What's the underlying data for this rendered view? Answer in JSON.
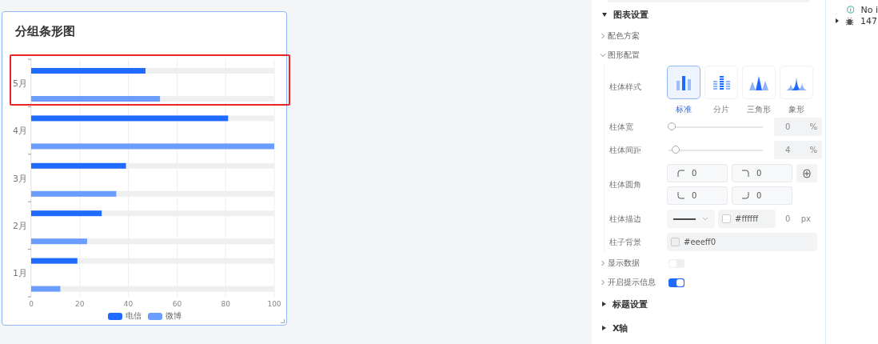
{
  "chart_card": {
    "title": "分组条形图",
    "highlight": {
      "kind": "box"
    },
    "bar_background": "#eeeff0",
    "chart_data": {
      "type": "bar",
      "orientation": "horizontal",
      "categories": [
        "5月",
        "4月",
        "3月",
        "2月",
        "1月"
      ],
      "series": [
        {
          "name": "电信",
          "color": "#1f6bff",
          "values": [
            47,
            81,
            39,
            29,
            19
          ]
        },
        {
          "name": "微博",
          "color": "#6b9cff",
          "values": [
            53,
            100,
            35,
            23,
            12
          ]
        }
      ],
      "xlim": [
        0,
        100
      ],
      "xticks": [
        0,
        20,
        40,
        60,
        80,
        100
      ],
      "grid": true
    }
  },
  "settings": {
    "sections": [
      {
        "title": "图表设置",
        "expanded": true,
        "groups": [
          {
            "title": "配色方案",
            "expanded": false
          },
          {
            "title": "图形配置",
            "expanded": true,
            "fields": [
              {
                "kind": "styles",
                "label": "柱体样式",
                "options": [
                  {
                    "kind": "standard",
                    "label": "标准",
                    "selected": true
                  },
                  {
                    "kind": "segmented",
                    "label": "分片",
                    "selected": false
                  },
                  {
                    "kind": "triangle",
                    "label": "三角形",
                    "selected": false
                  },
                  {
                    "kind": "pictorial",
                    "label": "象形",
                    "selected": false
                  }
                ]
              },
              {
                "kind": "slider",
                "label": "柱体宽",
                "level": 0,
                "value": "0",
                "unit": "%"
              },
              {
                "kind": "slider",
                "label": "柱体间距",
                "level": 0.04,
                "value": "4",
                "unit": "%"
              },
              {
                "kind": "corners",
                "label": "柱体圆角",
                "values": [
                  "0",
                  "0",
                  "0",
                  "0"
                ]
              },
              {
                "kind": "stroke",
                "label": "柱体描边",
                "color": "#ffffff",
                "value": "0",
                "unit": "px"
              },
              {
                "kind": "color",
                "label": "柱子背景",
                "color": "#eeeff0"
              }
            ]
          },
          {
            "title": "显示数据",
            "expanded": false,
            "toggle": {
              "on": false
            }
          },
          {
            "title": "开启提示信息",
            "expanded": false,
            "toggle": {
              "on": true
            }
          }
        ]
      },
      {
        "title": "标题设置",
        "expanded": false
      },
      {
        "title": "X轴",
        "expanded": false
      }
    ]
  },
  "side_panel": {
    "items": [
      {
        "kind": "info",
        "text": "No i"
      },
      {
        "kind": "bug",
        "text": "147",
        "expanded": false
      }
    ]
  }
}
